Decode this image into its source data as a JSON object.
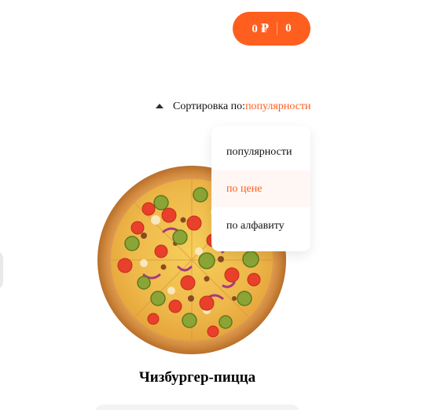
{
  "header": {
    "cart": {
      "price": "0 ₽",
      "count": "0"
    }
  },
  "sort": {
    "label": "Сортировка по:",
    "selected": "популярности",
    "options": [
      "популярности",
      "по цене",
      "по алфавиту"
    ],
    "highlighted_option": "по цене"
  },
  "pizza": {
    "title": "Чизбургер-пицца"
  },
  "colors": {
    "accent": "#fe5f1e",
    "text": "#111111",
    "highlight_bg": "#fff7f4"
  }
}
